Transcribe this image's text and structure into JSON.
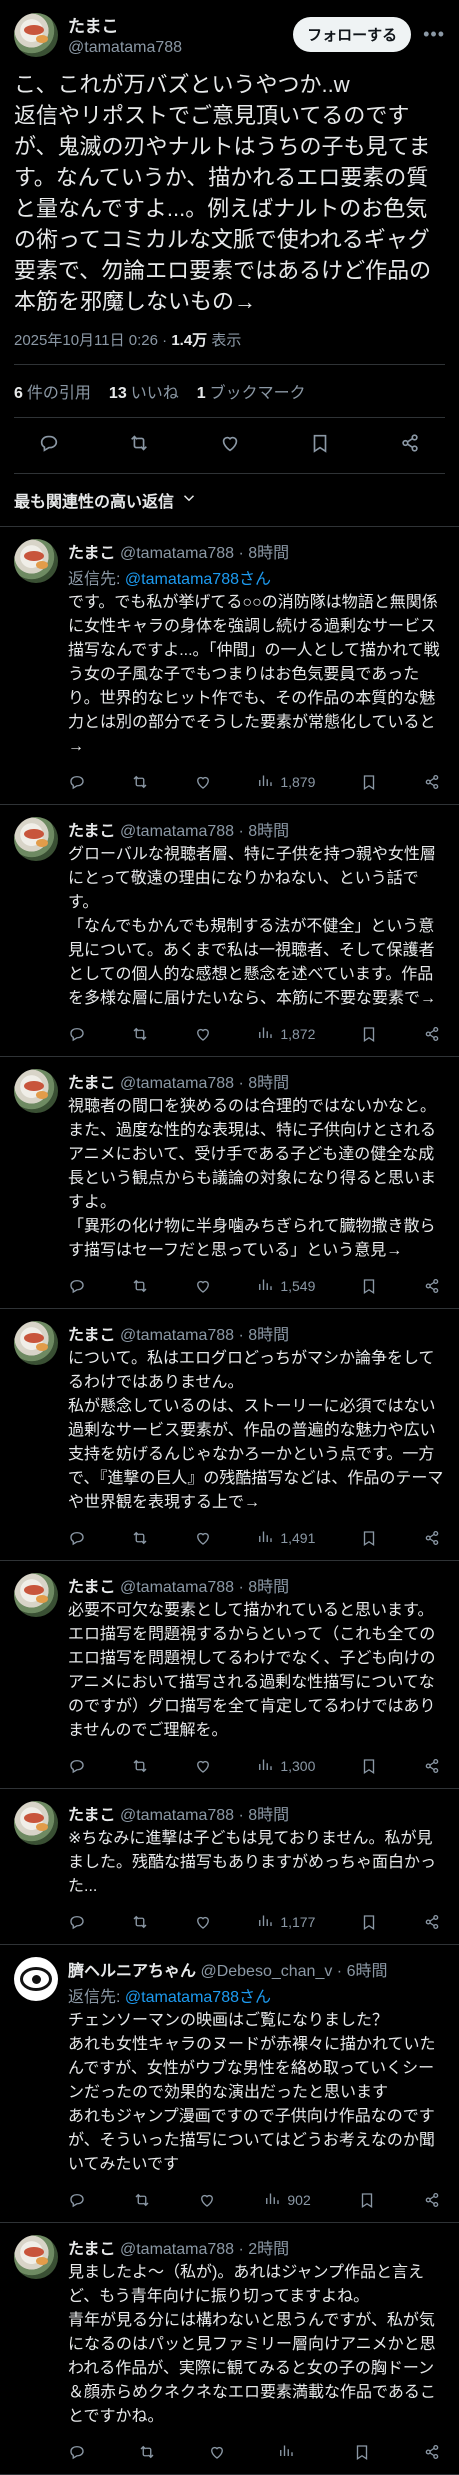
{
  "post": {
    "display_name": "たまこ",
    "handle": "@tamatama788",
    "follow_label": "フォローする",
    "text": "こ、これが万バズというやつか..w\n返信やリポストでご意見頂いてるのですが、鬼滅の刃やナルトはうちの子も見てます。なんていうか、描かれるエロ要素の質と量なんですよ...。例えばナルトのお色気の術ってコミカルな文脈で使われるギャグ要素で、勿論エロ要素ではあるけど作品の本筋を邪魔しないもの→",
    "timestamp": "2025年10月11日 0:26 · ",
    "views_value": "1.4万",
    "views_label": " 表示",
    "quotes_count": "6",
    "quotes_label": "件の引用",
    "likes_count": "13",
    "likes_label": "いいね",
    "bookmarks_count": "1",
    "bookmarks_label": "ブックマーク"
  },
  "sort_label": "最も関連性の高い返信",
  "replies": [
    {
      "name": "たまこ",
      "meta": " @tamatama788 · 8時間",
      "reply_prefix": "返信先: ",
      "reply_mention": "@tamatama788さん",
      "text": "です。でも私が挙げてる○○の消防隊は物語と無関係に女性キャラの身体を強調し続ける過剰なサービス描写なんですよ...。「仲間」の一人として描かれて戦う女の子風な子でもつまりはお色気要員であったり。世界的なヒット作でも、その作品の本質的な魅力とは別の部分でそうした要素が常態化していると→",
      "views": "1,879"
    },
    {
      "name": "たまこ",
      "meta": " @tamatama788 · 8時間",
      "text": "グローバルな視聴者層、特に子供を持つ親や女性層にとって敬遠の理由になりかねない、という話です。\n「なんでもかんでも規制する法が不健全」という意見について。あくまで私は一視聴者、そして保護者としての個人的な感想と懸念を述べています。作品を多様な層に届けたいなら、本筋に不要な要素で→",
      "views": "1,872"
    },
    {
      "name": "たまこ",
      "meta": " @tamatama788 · 8時間",
      "text": "視聴者の間口を狭めるのは合理的ではないかなと。また、過度な性的な表現は、特に子供向けとされるアニメにおいて、受け手である子ども達の健全な成長という観点からも議論の対象になり得ると思いますよ。\n「異形の化け物に半身噛みちぎられて臓物撒き散らす描写はセーフだと思っている」という意見→",
      "views": "1,549"
    },
    {
      "name": "たまこ",
      "meta": " @tamatama788 · 8時間",
      "text": "について。私はエログロどっちがマシか論争をしてるわけではありません。\n私が懸念しているのは、ストーリーに必須ではない過剰なサービス要素が、作品の普遍的な魅力や広い支持を妨げるんじゃなかろーかという点です。一方で、『進撃の巨人』の残酷描写などは、作品のテーマや世界観を表現する上で→",
      "views": "1,491"
    },
    {
      "name": "たまこ",
      "meta": " @tamatama788 · 8時間",
      "text": "必要不可欠な要素として描かれていると思います。エロ描写を問題視するからといって（これも全てのエロ描写を問題視してるわけでなく、子ども向けのアニメにおいて描写される過剰な性描写についてなのですが）グロ描写を全て肯定してるわけではありませんのでご理解を。",
      "views": "1,300"
    },
    {
      "name": "たまこ",
      "meta": " @tamatama788 · 8時間",
      "text": "※ちなみに進撃は子どもは見ておりません。私が見ました。残酷な描写もありますがめっちゃ面白かった...",
      "views": "1,177"
    },
    {
      "name": "臍ヘルニアちゃん",
      "meta": " @Debeso_chan_v · 6時間",
      "reply_prefix": "返信先: ",
      "reply_mention": "@tamatama788さん",
      "text": "チェンソーマンの映画はご覧になりました？\nあれも女性キャラのヌードが赤裸々に描かれていたんですが、女性がウブな男性を絡め取っていくシーンだったので効果的な演出だったと思います\nあれもジャンプ漫画ですので子供向け作品なのですが、そういった描写についてはどうお考えなのか聞いてみたいです",
      "views": "902"
    },
    {
      "name": "たまこ",
      "meta": " @tamatama788 · 2時間",
      "text": "見ましたよ〜（私が)。あれはジャンプ作品と言えど、もう青年向けに振り切ってますよね。\n青年が見る分には構わないと思うんですが、私が気になるのはパッと見ファミリー層向けアニメかと思われる作品が、実際に観てみると女の子の胸ドーン＆顔赤らめクネクネなエロ要素満載な作品であることですかね。",
      "views": ""
    }
  ],
  "icons": [
    "more-icon",
    "reply-icon",
    "repost-icon",
    "like-icon",
    "bookmark-icon",
    "share-icon",
    "views-icon",
    "chevron-down-icon",
    "avatar"
  ]
}
